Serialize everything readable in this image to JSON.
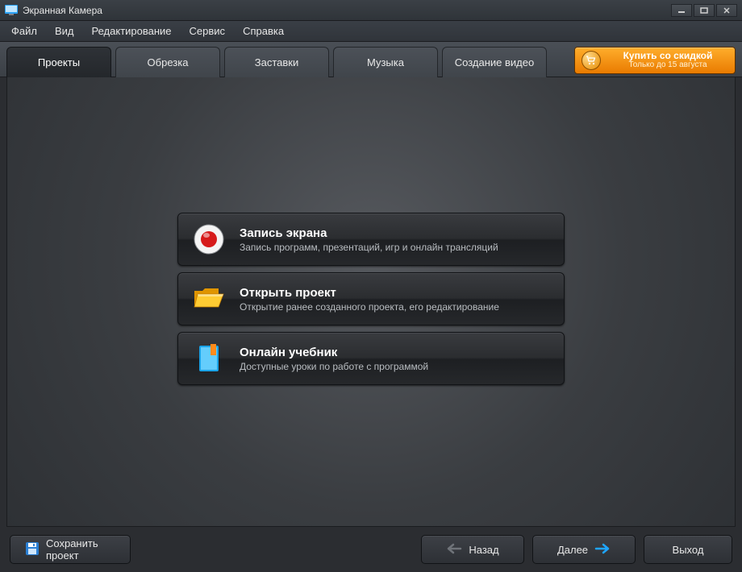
{
  "app": {
    "title": "Экранная Камера"
  },
  "menu": {
    "file": "Файл",
    "view": "Вид",
    "edit": "Редактирование",
    "service": "Сервис",
    "help": "Справка"
  },
  "tabs": {
    "projects": "Проекты",
    "crop": "Обрезка",
    "intro": "Заставки",
    "music": "Музыка",
    "create": "Создание видео"
  },
  "buy": {
    "label": "Купить со скидкой",
    "sub": "Только до 15 августа"
  },
  "actions": {
    "record": {
      "title": "Запись экрана",
      "sub": "Запись программ, презентаций, игр и онлайн трансляций"
    },
    "open": {
      "title": "Открыть проект",
      "sub": "Открытие ранее созданного проекта, его редактирование"
    },
    "help": {
      "title": "Онлайн учебник",
      "sub": "Доступные уроки по работе с программой"
    }
  },
  "footer": {
    "save": "Сохранить проект",
    "back": "Назад",
    "next": "Далее",
    "exit": "Выход"
  }
}
